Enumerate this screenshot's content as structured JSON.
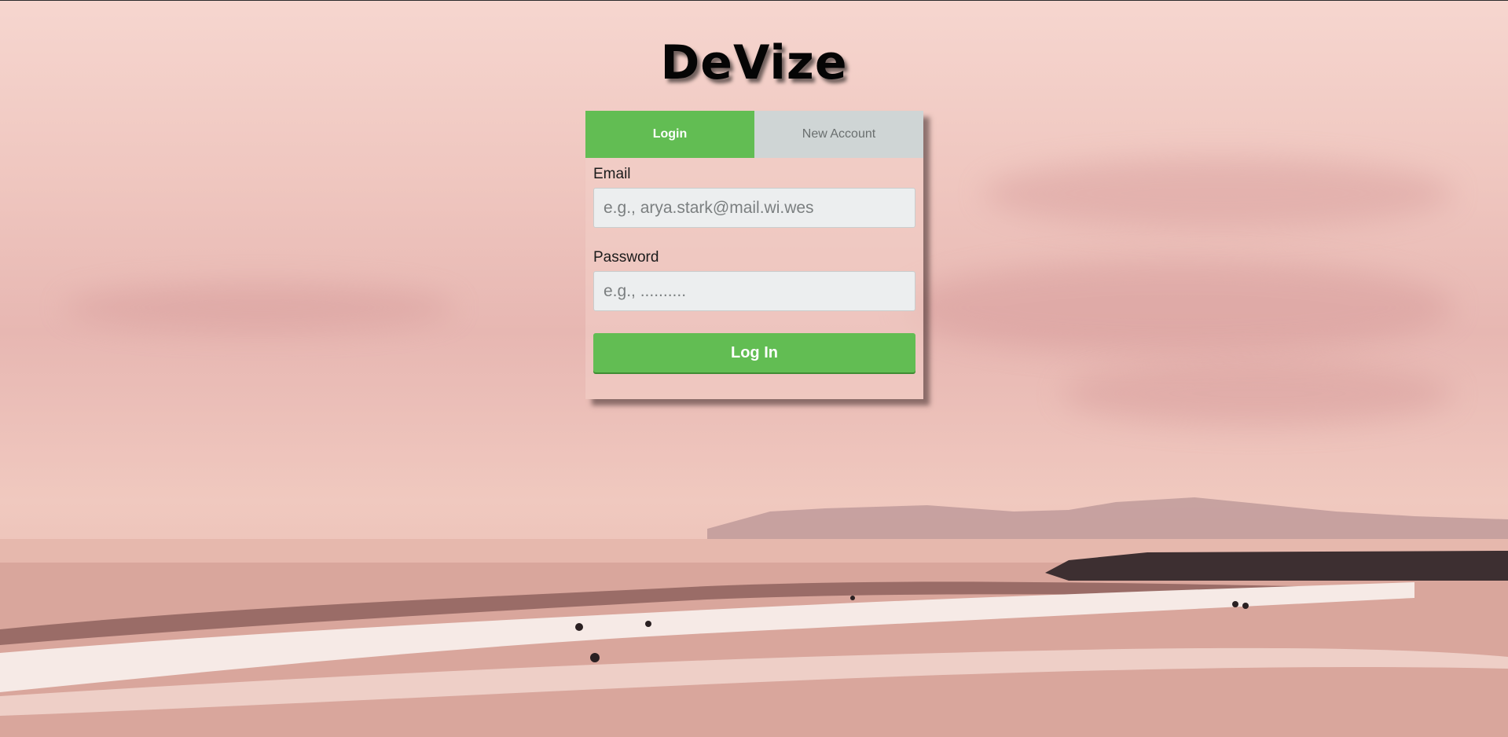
{
  "app": {
    "logo_text": "DeVize"
  },
  "tabs": [
    {
      "label": "Login",
      "active": true
    },
    {
      "label": "New Account",
      "active": false
    }
  ],
  "form": {
    "email": {
      "label": "Email",
      "value": "",
      "placeholder": "e.g., arya.stark@mail.wi.wes"
    },
    "password": {
      "label": "Password",
      "value": "",
      "placeholder": "e.g., .........."
    },
    "submit_label": "Log In"
  },
  "colors": {
    "accent": "#62bd53",
    "inactive_tab": "#cfd5d5",
    "input_bg": "#eceeef"
  }
}
